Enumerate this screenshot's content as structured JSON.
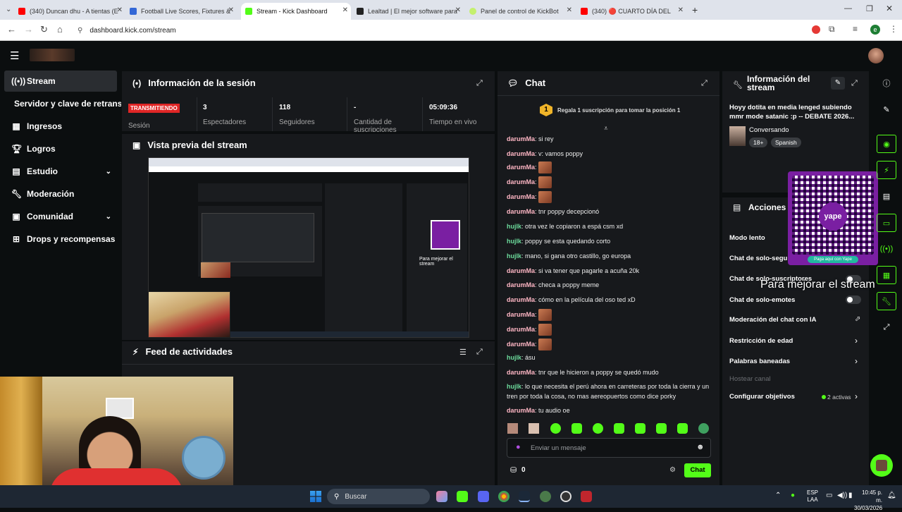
{
  "browser": {
    "tabs": [
      {
        "title": "(340) Duncan dhu - A tientas (E",
        "color": "#ff0000"
      },
      {
        "title": "Football Live Scores, Fixtures &",
        "color": "#3367d6"
      },
      {
        "title": "Stream - Kick Dashboard",
        "color": "#53fc18"
      },
      {
        "title": "Lealtad | El mejor software para",
        "color": "#222222"
      },
      {
        "title": "Panel de control de KickBot",
        "color": "#c4f06e"
      },
      {
        "title": "(340) 🔴 CUARTO DÍA DEL",
        "color": "#ff0000"
      }
    ],
    "new_tab": "+",
    "url": "dashboard.kick.com/stream",
    "profile_initial": "e"
  },
  "sidebar": {
    "items": [
      {
        "label": "Stream",
        "icon": "broadcast-icon"
      },
      {
        "label": "Servidor y clave de retransmisión"
      },
      {
        "label": "Ingresos",
        "icon": "revenue-icon"
      },
      {
        "label": "Logros",
        "icon": "trophy-icon"
      },
      {
        "label": "Estudio",
        "icon": "studio-icon"
      },
      {
        "label": "Moderación",
        "icon": "wrench-icon"
      },
      {
        "label": "Comunidad",
        "icon": "community-icon"
      },
      {
        "label": "Drops y recompensas",
        "icon": "drops-icon"
      }
    ]
  },
  "session": {
    "title": "Información de la sesión",
    "live_badge": "TRANSMITIENDO",
    "session_label": "Sesión",
    "stats": [
      {
        "value": "3",
        "label": "Espectadores"
      },
      {
        "value": "118",
        "label": "Seguidores"
      },
      {
        "value": "-",
        "label": "Cantidad de suscripciones"
      },
      {
        "value": "05:09:36",
        "label": "Tiempo en vivo"
      }
    ]
  },
  "preview": {
    "title": "Vista previa del stream",
    "overlay_text": "Para mejorar el stream"
  },
  "feed": {
    "title": "Feed de actividades"
  },
  "chat": {
    "title": "Chat",
    "gift_rank": "1",
    "gift_text": "Regala 1 suscripción para tomar la posición 1",
    "messages": [
      {
        "user": "darumMa",
        "text": "si rey",
        "color": "pink"
      },
      {
        "user": "darumMa",
        "text": "v: vamos poppy",
        "color": "pink"
      },
      {
        "user": "darumMa",
        "text": "",
        "emote": true,
        "color": "pink"
      },
      {
        "user": "darumMa",
        "text": "",
        "emote": true,
        "color": "pink"
      },
      {
        "user": "darumMa",
        "text": "",
        "emote": true,
        "color": "pink"
      },
      {
        "user": "darumMa",
        "text": "tnr poppy decepcionó",
        "color": "pink"
      },
      {
        "user": "hujlk",
        "text": "otra vez le copiaron a espá csm xd",
        "color": "green"
      },
      {
        "user": "hujlk",
        "text": "poppy se esta quedando corto",
        "color": "green"
      },
      {
        "user": "hujlk",
        "text": "mano, si gana otro castillo, go europa",
        "color": "green"
      },
      {
        "user": "darumMa",
        "text": "si va tener que pagarle a acuña 20k",
        "color": "pink"
      },
      {
        "user": "darumMa",
        "text": "checa a poppy meme",
        "color": "pink"
      },
      {
        "user": "darumMa",
        "text": "cómo en la película del oso ted xD",
        "color": "pink"
      },
      {
        "user": "darumMa",
        "text": "",
        "emote": true,
        "color": "pink"
      },
      {
        "user": "darumMa",
        "text": "",
        "emote": true,
        "color": "pink"
      },
      {
        "user": "darumMa",
        "text": "",
        "emote": true,
        "color": "pink"
      },
      {
        "user": "hujlk",
        "text": "ásu",
        "color": "green"
      },
      {
        "user": "darumMa",
        "text": "tnr que le hicieron a poppy se quedó mudo",
        "color": "pink"
      },
      {
        "user": "hujlk",
        "text": "lo que necesita el perú ahora en carreteras por toda la cierra y un tren por toda la cosa, no mas aereopuertos como dice porky",
        "color": "green"
      },
      {
        "user": "darumMa",
        "text": "tu audio oe",
        "color": "pink"
      }
    ],
    "input_placeholder": "Enviar un mensaje",
    "points": "0",
    "send_label": "Chat"
  },
  "stream_info": {
    "title": "Información del stream",
    "stream_title": "Hoyy dotita en media lenged subiendo mmr mode satanic :p -- DEBATE 2026...",
    "category": "Conversando",
    "tags": [
      "18+",
      "Spanish"
    ]
  },
  "actions": {
    "title": "Acciones",
    "items": [
      {
        "label": "Modo lento"
      },
      {
        "label": "Chat de solo-seguidores"
      },
      {
        "label": "Chat de solo-suscriptores"
      },
      {
        "label": "Chat de solo-emotes"
      },
      {
        "label": "Moderación del chat con IA"
      },
      {
        "label": "Restricción de edad"
      },
      {
        "label": "Palabras baneadas"
      },
      {
        "label": "Hostear canal"
      },
      {
        "label": "Configurar objetivos"
      }
    ],
    "goals_badge": "2 activas"
  },
  "overlay": {
    "qr_caption": "Paga aquí con Yape",
    "qr_brand": "yape",
    "overlay_text": "Para mejorar el stream"
  },
  "taskbar": {
    "search_placeholder": "Buscar",
    "lang_top": "ESP",
    "lang_bottom": "LAA",
    "time": "10:45 p. m.",
    "date": "30/03/2026"
  },
  "colors": {
    "kick_green": "#53fc18",
    "panel_bg": "#17191c",
    "live_red": "#e02626"
  }
}
